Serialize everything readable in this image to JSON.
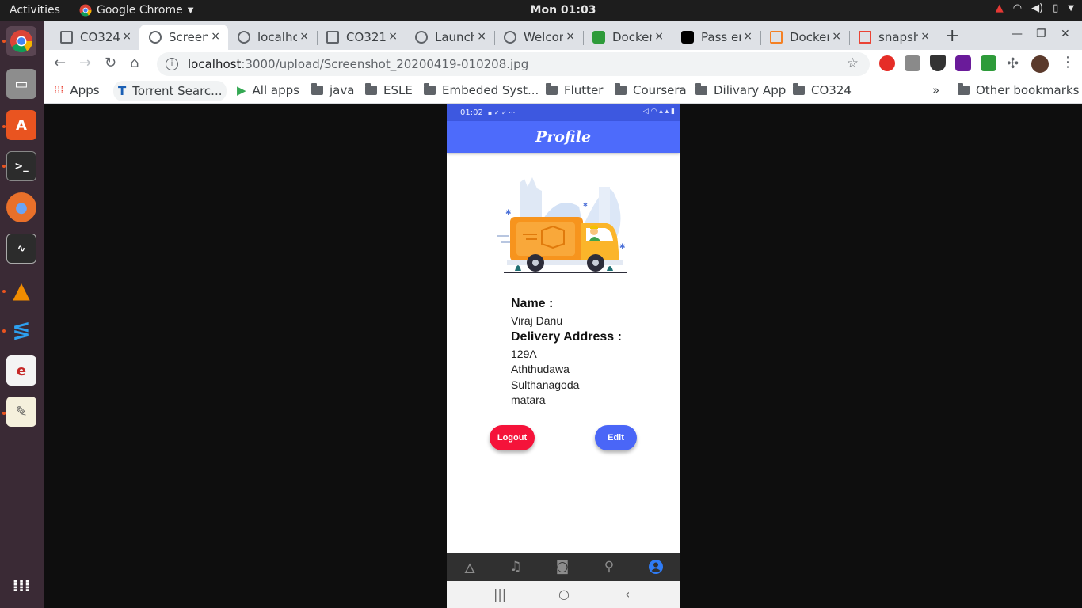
{
  "topbar": {
    "activities": "Activities",
    "app_name": "Google Chrome",
    "clock": "Mon 01:03"
  },
  "tabs": [
    {
      "title": "CO324"
    },
    {
      "title": "Screen"
    },
    {
      "title": "localho"
    },
    {
      "title": "CO321"
    },
    {
      "title": "Launch"
    },
    {
      "title": "Welcor"
    },
    {
      "title": "Docker"
    },
    {
      "title": "Pass er"
    },
    {
      "title": "Docker"
    },
    {
      "title": "snapsh"
    }
  ],
  "tab_close": "×",
  "toolbar": {
    "url_host": "localhost",
    "url_path": ":3000/upload/Screenshot_20200419-010208.jpg"
  },
  "bookmarks": {
    "apps": "Apps",
    "torrent": "Torrent Searc...",
    "all_apps": "All apps",
    "java": "java",
    "esle": "ESLE",
    "embedded": "Embeded Syst...",
    "flutter": "Flutter",
    "coursera": "Coursera",
    "dilivary": "Dilivary App",
    "co324": "CO324",
    "overflow": "»",
    "other": "Other bookmarks"
  },
  "phone": {
    "status_time": "01:02",
    "title": "Profile",
    "name_label": "Name :",
    "name_value": "Viraj Danu",
    "address_label": "Delivery Address :",
    "address_lines": [
      "129A",
      "Aththudawa",
      "Sulthanagoda",
      "matara"
    ],
    "logout_label": "Logout",
    "edit_label": "Edit"
  },
  "colors": {
    "app_blue": "#4d6bfb",
    "logout_red": "#f5133a",
    "edit_blue": "#4a66f7",
    "nav_active": "#2f7cf6"
  }
}
